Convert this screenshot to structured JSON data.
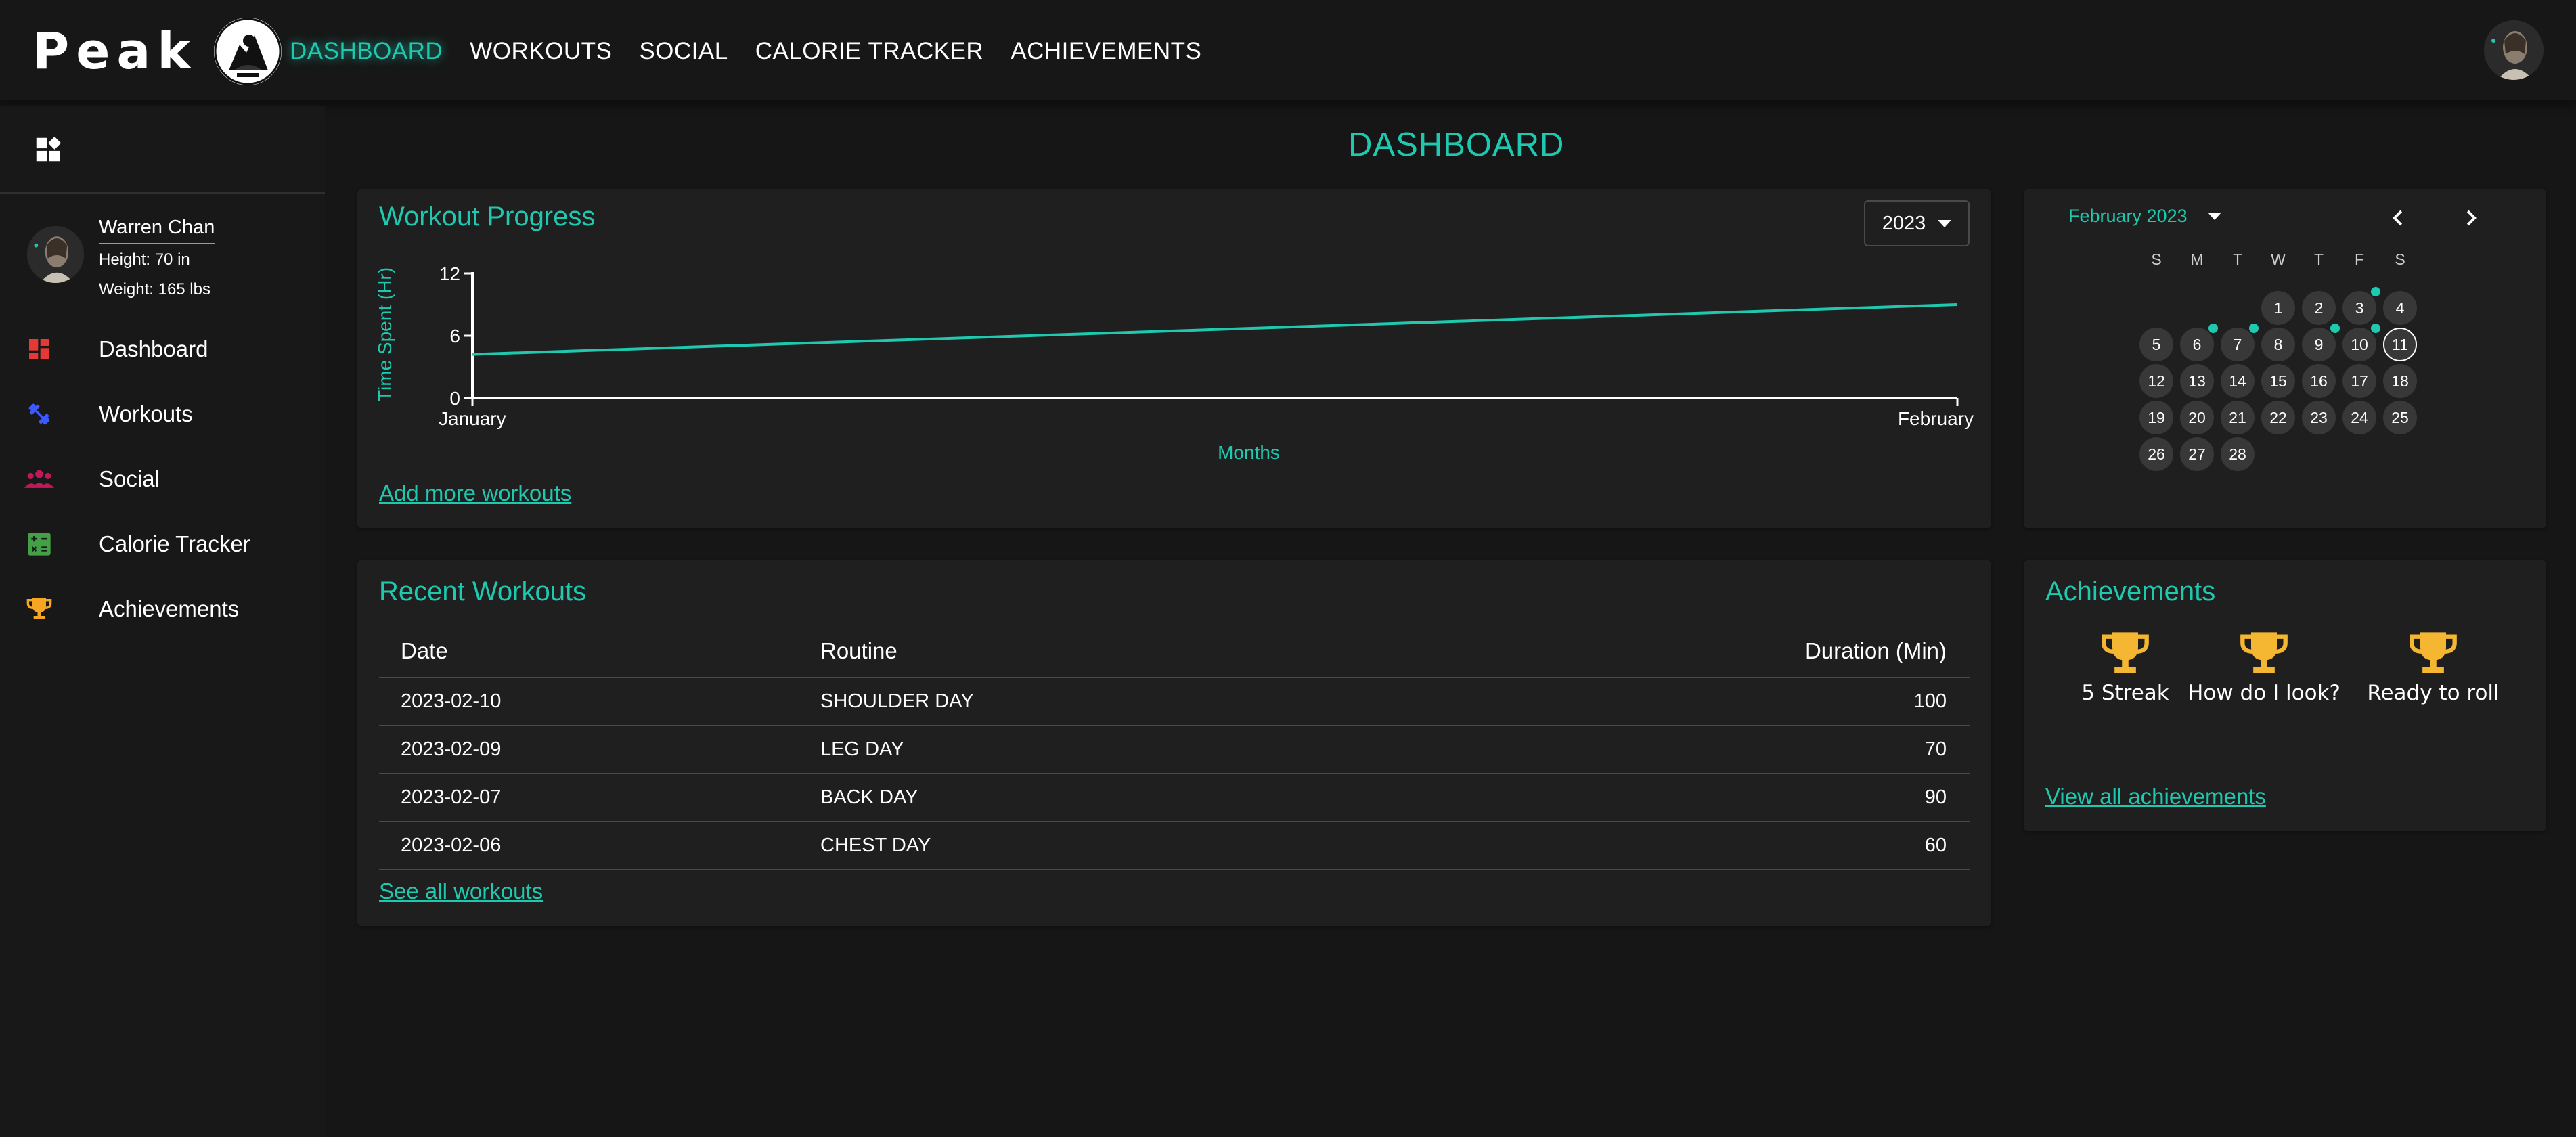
{
  "brand": {
    "name": "Peak",
    "logo_icon": "peak-logo-icon"
  },
  "nav": {
    "items": [
      "DASHBOARD",
      "WORKOUTS",
      "SOCIAL",
      "CALORIE TRACKER",
      "ACHIEVEMENTS"
    ],
    "active": "DASHBOARD"
  },
  "profile": {
    "name": "Warren Chan",
    "height": "Height: 70 in",
    "weight": "Weight: 165 lbs"
  },
  "sidebar": {
    "items": [
      {
        "label": "Dashboard",
        "icon": "dashboard-icon",
        "color": "#e53935"
      },
      {
        "label": "Workouts",
        "icon": "dumbbell-icon",
        "color": "#3d5afe"
      },
      {
        "label": "Social",
        "icon": "people-icon",
        "color": "#c2185b"
      },
      {
        "label": "Calorie Tracker",
        "icon": "calculator-icon",
        "color": "#43a047"
      },
      {
        "label": "Achievements",
        "icon": "trophy-icon",
        "color": "#f5a623"
      }
    ]
  },
  "page": {
    "title": "DASHBOARD"
  },
  "progress": {
    "title": "Workout Progress",
    "year": "2023",
    "add_link": "Add more workouts"
  },
  "chart_data": {
    "type": "line",
    "categories": [
      "January",
      "February"
    ],
    "series": [
      {
        "values": [
          4.2,
          9.0
        ],
        "color": "#1fc9b0"
      }
    ],
    "xlabel": "Months",
    "ylabel": "Time Spent (Hr)",
    "yticks": [
      0,
      6,
      12
    ],
    "ylim": [
      0,
      12
    ],
    "grid": false
  },
  "calendar": {
    "month": "February 2023",
    "weekdays": [
      "S",
      "M",
      "T",
      "W",
      "T",
      "F",
      "S"
    ],
    "first_weekday": 3,
    "days": 28,
    "today": 11,
    "workout_days": [
      3,
      6,
      7,
      9,
      10
    ],
    "prev_icon": "chevron-left-icon",
    "next_icon": "chevron-right-icon"
  },
  "recent": {
    "title": "Recent Workouts",
    "columns": [
      "Date",
      "Routine",
      "Duration (Min)"
    ],
    "rows": [
      {
        "date": "2023-02-10",
        "routine": "SHOULDER DAY",
        "duration": "100"
      },
      {
        "date": "2023-02-09",
        "routine": "LEG DAY",
        "duration": "70"
      },
      {
        "date": "2023-02-07",
        "routine": "BACK DAY",
        "duration": "90"
      },
      {
        "date": "2023-02-06",
        "routine": "CHEST DAY",
        "duration": "60"
      }
    ],
    "see_link": "See all workouts"
  },
  "achievements": {
    "title": "Achievements",
    "items": [
      {
        "label": "5 Streak",
        "icon": "trophy-icon"
      },
      {
        "label": "How do I look?",
        "icon": "trophy-icon"
      },
      {
        "label": "Ready to roll",
        "icon": "trophy-icon"
      }
    ],
    "view_link": "View all achievements",
    "trophy_color": "#f5b731"
  },
  "colors": {
    "accent": "#1fc9b0",
    "background": "#161616",
    "card": "#1f1f1f"
  }
}
